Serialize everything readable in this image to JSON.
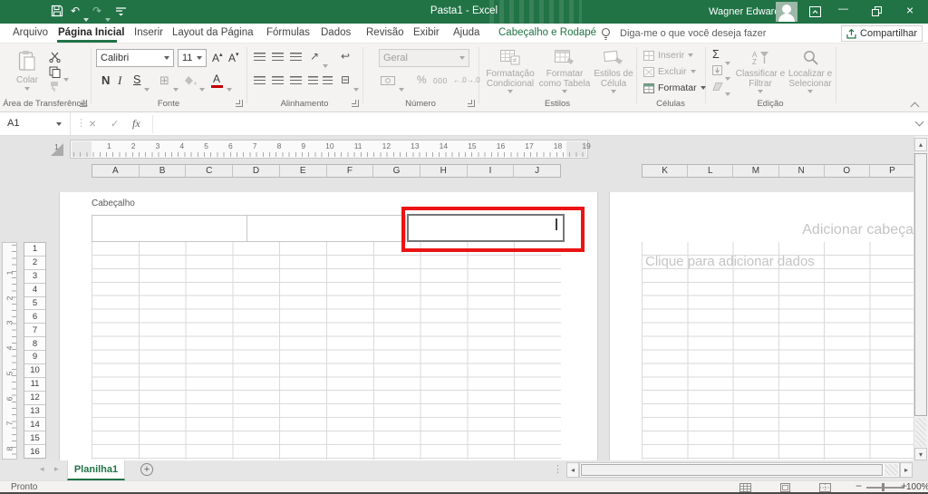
{
  "titlebar": {
    "title": "Pasta1 - Excel",
    "user": "Wagner Edwards"
  },
  "tabs": {
    "arquivo": "Arquivo",
    "pagina_inicial": "Página Inicial",
    "inserir": "Inserir",
    "layout": "Layout da Página",
    "formulas": "Fórmulas",
    "dados": "Dados",
    "revisao": "Revisão",
    "exibir": "Exibir",
    "ajuda": "Ajuda",
    "contextual": "Cabeçalho e Rodapé",
    "tell_me": "Diga-me o que você deseja fazer",
    "share": "Compartilhar"
  },
  "ribbon": {
    "clipboard": {
      "group": "Área de Transferência",
      "paste": "Colar"
    },
    "font": {
      "group": "Fonte",
      "family": "Calibri",
      "size": "11",
      "bold": "N",
      "italic": "I",
      "underline": "S",
      "color_letter": "A",
      "grow": "A",
      "shrink": "A"
    },
    "alignment": {
      "group": "Alinhamento"
    },
    "number": {
      "group": "Número",
      "format": "Geral",
      "percent": "%",
      "thousands": "000",
      "inc_decimal": "←.0",
      "dec_decimal": "→.0"
    },
    "styles": {
      "group": "Estilos",
      "conditional": "Formatação Condicional",
      "table": "Formatar como Tabela",
      "cell": "Estilos de Célula"
    },
    "cells": {
      "group": "Células",
      "insert": "Inserir",
      "delete": "Excluir",
      "format": "Formatar"
    },
    "editing": {
      "group": "Edição",
      "autosum": "Σ",
      "sort_a": "A",
      "sort_z": "Z",
      "sort": "Classificar e Filtrar",
      "find": "Localizar e Selecionar"
    }
  },
  "formula_bar": {
    "name_box": "A1",
    "cancel": "×",
    "enter": "✓",
    "fx": "fx"
  },
  "ruler": {
    "margin_number": "1",
    "h_numbers": [
      "1",
      "2",
      "3",
      "4",
      "5",
      "6",
      "7",
      "8",
      "9",
      "10",
      "11",
      "12",
      "13",
      "14",
      "15",
      "16",
      "17",
      "18",
      "19"
    ],
    "v_numbers": [
      "1",
      "2",
      "3",
      "4",
      "5",
      "6",
      "7",
      "8"
    ]
  },
  "grid": {
    "columns_page1": [
      "A",
      "B",
      "C",
      "D",
      "E",
      "F",
      "G",
      "H",
      "I",
      "J"
    ],
    "columns_page2": [
      "K",
      "L",
      "M",
      "N",
      "O",
      "P"
    ],
    "rows": [
      "1",
      "2",
      "3",
      "4",
      "5",
      "6",
      "7",
      "8",
      "9",
      "10",
      "11",
      "12",
      "13",
      "14",
      "15",
      "16"
    ]
  },
  "page": {
    "header_section_label": "Cabeçalho",
    "add_header_placeholder": "Adicionar cabeça",
    "add_data_placeholder": "Clique para adicionar dados"
  },
  "sheet_tabs": {
    "active": "Planilha1"
  },
  "status": {
    "mode": "Pronto",
    "zoom": "100%",
    "minus": "−",
    "plus": "+"
  },
  "icons": {
    "undo": "↶",
    "redo": "↷",
    "prev": "◂",
    "next": "▸",
    "up": "▴",
    "down": "▾",
    "left": "◂",
    "right": "▸",
    "close": "×",
    "minimize": "—",
    "dots": "⋮",
    "borders": "⊞",
    "merge": "⊟",
    "wrap": "↩",
    "orientation": "↗",
    "plus_sheet": "+"
  },
  "colors": {
    "titlebar_green": "#217346",
    "accent_green": "#217346",
    "annotation_red": "#EC1313",
    "font_color_red": "#C00000"
  }
}
